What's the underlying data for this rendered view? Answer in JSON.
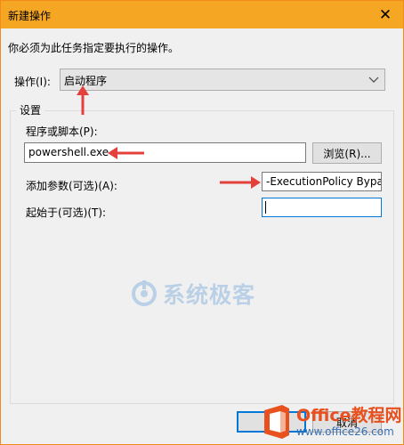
{
  "window": {
    "title": "新建操作",
    "close_glyph": "✕"
  },
  "instruction": "你必须为此任务指定要执行的操作。",
  "action": {
    "label": "操作(I):",
    "value": "启动程序"
  },
  "settings": {
    "title": "设置",
    "program_label": "程序或脚本(P):",
    "program_value": "powershell.exe",
    "browse_label": "浏览(R)...",
    "args_label": "添加参数(可选)(A):",
    "args_value": "-ExecutionPolicy Bypass",
    "start_label": "起始于(可选)(T):",
    "start_value": ""
  },
  "buttons": {
    "ok_label": "",
    "cancel_label": "取消"
  },
  "watermarks": {
    "center_text": "系统极客",
    "brand": "Office教程网",
    "url": "www.office26.com"
  },
  "colors": {
    "titlebar": "#f5a623",
    "arrow": "#e5413c",
    "focus": "#0078d7"
  }
}
